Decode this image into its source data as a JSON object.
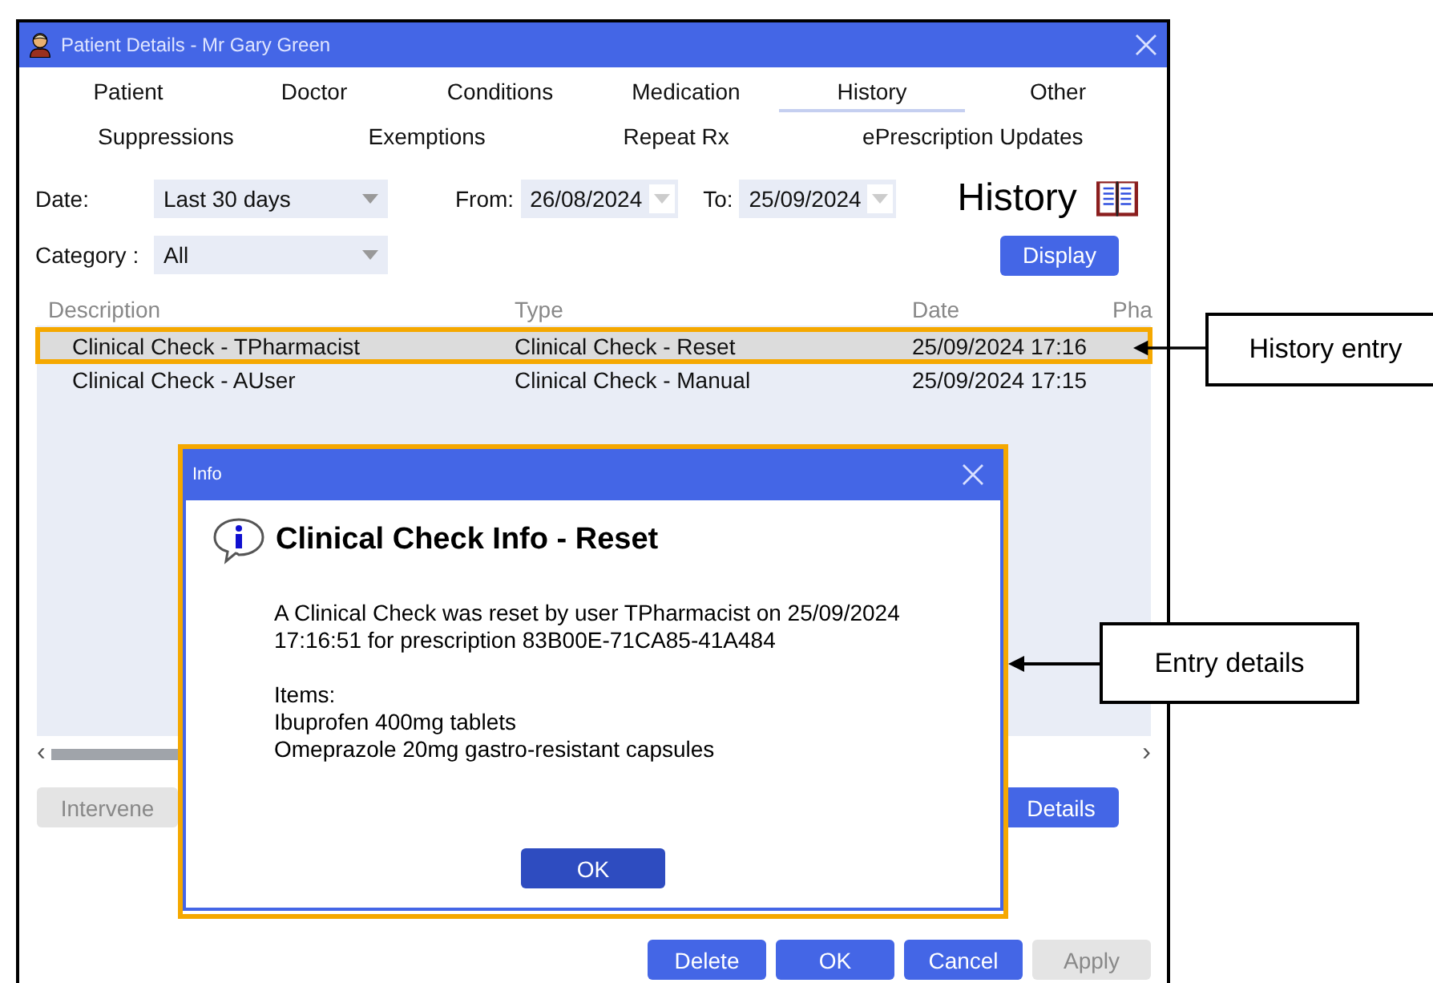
{
  "window": {
    "title": "Patient Details - Mr Gary Green"
  },
  "tabs": [
    {
      "label": "Patient",
      "selected": false
    },
    {
      "label": "Doctor",
      "selected": false
    },
    {
      "label": "Conditions",
      "selected": false
    },
    {
      "label": "Medication",
      "selected": false
    },
    {
      "label": "History",
      "selected": true
    },
    {
      "label": "Other",
      "selected": false
    }
  ],
  "tabs_row_2": [
    {
      "label": "Suppressions",
      "selected": false
    },
    {
      "label": "Exemptions",
      "selected": false
    },
    {
      "label": "Repeat Rx",
      "selected": false
    },
    {
      "label": "ePrescription Updates",
      "selected": false
    }
  ],
  "filters": {
    "date_label": "Date:",
    "date_value": "Last 30 days",
    "from_label": "From:",
    "from_value": "26/08/2024",
    "to_label": "To:",
    "to_value": "25/09/2024",
    "category_label": "Category :",
    "category_value": "All"
  },
  "heading": "History",
  "display_button": "Display",
  "table": {
    "columns": [
      "Description",
      "Type",
      "Date",
      "Pha"
    ],
    "rows": [
      {
        "cells": [
          "Clinical Check - TPharmacist",
          "Clinical Check - Reset",
          "25/09/2024 17:16"
        ],
        "selected": true,
        "annotated": true
      },
      {
        "cells": [
          "Clinical Check - AUser",
          "Clinical Check - Manual",
          "25/09/2024 17:15"
        ],
        "selected": false,
        "annotated": false
      }
    ]
  },
  "scroll_left": "‹",
  "scroll_right": "›",
  "action_buttons": [
    {
      "label": "Intervene",
      "disabled": true
    },
    {
      "label": "Details",
      "disabled": false
    }
  ],
  "footer_buttons": [
    {
      "label": "Delete",
      "disabled": false
    },
    {
      "label": "OK",
      "disabled": false
    },
    {
      "label": "Cancel",
      "disabled": false
    },
    {
      "label": "Apply",
      "disabled": true
    }
  ],
  "dialog": {
    "title": "Info",
    "heading": "Clinical Check Info - Reset",
    "message": "A Clinical Check was reset by user TPharmacist on 25/09/2024 17:16:51 for prescription 83B00E-71CA85-41A484",
    "items_label": "Items:",
    "items": [
      "Ibuprofen 400mg tablets",
      "Omeprazole 20mg gastro-resistant capsules"
    ],
    "button": "OK"
  },
  "callouts": [
    {
      "kind": "entry",
      "text": "History entry"
    },
    {
      "kind": "details",
      "text": "Entry details"
    }
  ]
}
